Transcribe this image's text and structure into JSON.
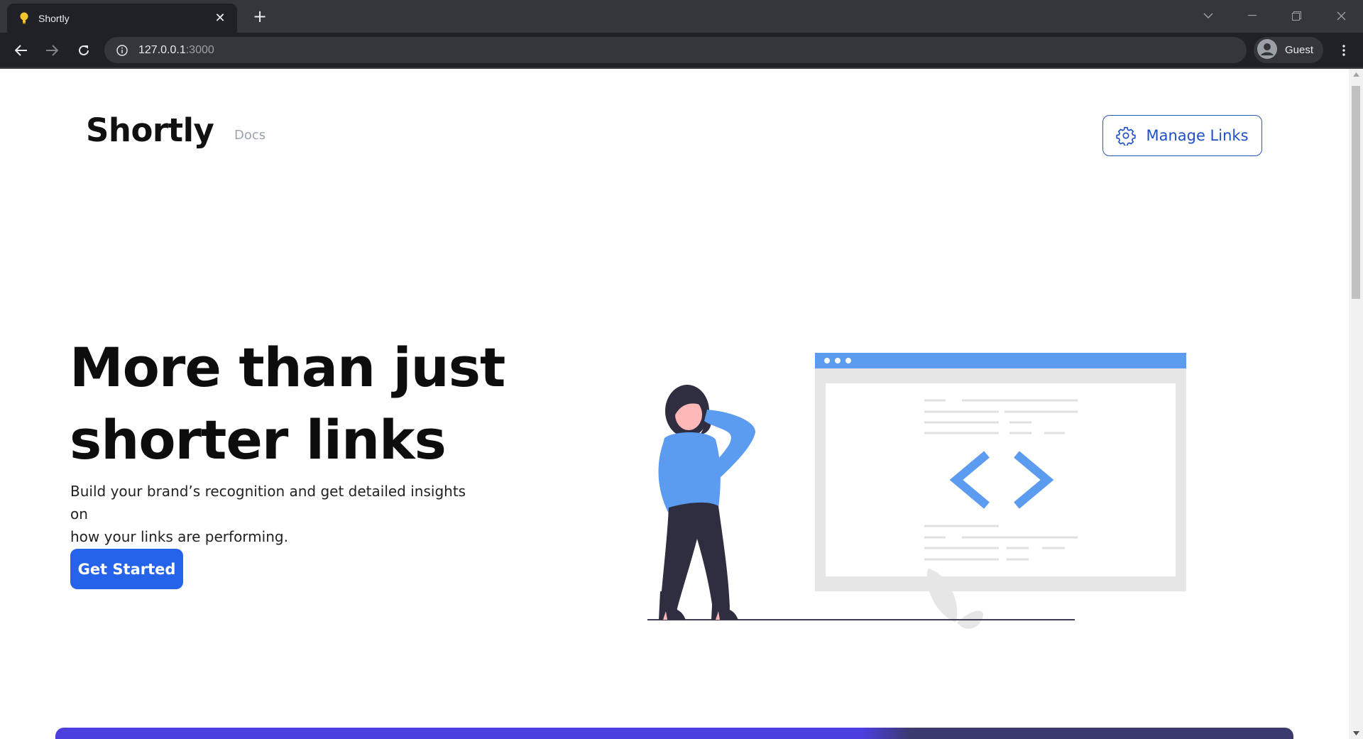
{
  "browser": {
    "tab_title": "Shortly",
    "url_host": "127.0.0.1",
    "url_port": ":3000",
    "profile_label": "Guest",
    "chrome_bg": "#35363a",
    "toolbar_bg": "#202124"
  },
  "header": {
    "brand": "Shortly",
    "nav_docs": "Docs",
    "manage_links": "Manage Links",
    "accent": "#1f4fc9"
  },
  "hero": {
    "title_line1": "More than just",
    "title_line2": "shorter links",
    "subtitle_line1": "Build your brand’s recognition and get detailed insights on",
    "subtitle_line2": "how your links are performing.",
    "cta": "Get Started",
    "cta_color": "#2563eb"
  },
  "illustration": {
    "type": "person-with-code-window",
    "accent": "#5b9bf0",
    "person_top": "#5b9bf0",
    "person_pants": "#2f2e41"
  },
  "footer_band": {
    "color_left": "#4c3fe0",
    "color_right": "#3b3a6e"
  }
}
